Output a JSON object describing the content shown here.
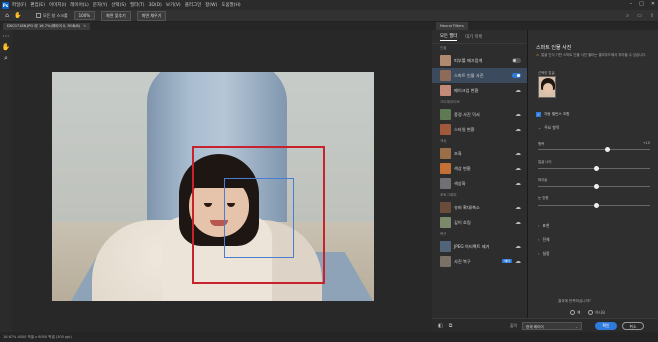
{
  "menubar": {
    "logo": "Ps",
    "items": [
      "파일(F)",
      "편집(E)",
      "이미지(I)",
      "레이어(L)",
      "문자(Y)",
      "선택(S)",
      "필터(T)",
      "3D(D)",
      "보기(V)",
      "플러그인",
      "창(W)",
      "도움말(H)"
    ],
    "window_controls": [
      "–",
      "□",
      "✕"
    ]
  },
  "options": {
    "check_label": "모든 창 스크롤",
    "zoom": "100%",
    "fit_btn": "화면 맞추기",
    "fill_btn": "화면 채우기"
  },
  "document": {
    "tab_label": "DSC07186.JPG @ 16.7%(레이어 0, RGB/8)",
    "close": "✕",
    "status": "16.67%   4000 픽셀 x 6000 픽셀 (300 ppi)"
  },
  "neural_filters": {
    "panel_title": "Neural Filters",
    "tabs": {
      "all": "모든 필터",
      "waitlist": "대기 목록"
    },
    "categories": [
      {
        "label": "인물",
        "items": [
          {
            "name": "피부를 매끄럽게",
            "control": "toggle",
            "on": false,
            "color": "#b08a6e"
          },
          {
            "name": "스마트 인물 사진",
            "control": "toggle",
            "on": true,
            "color": "#8e6b58",
            "selected": true
          },
          {
            "name": "메이크업 변환",
            "control": "cloud",
            "color": "#c48a78"
          }
        ]
      },
      {
        "label": "크리에이티브",
        "items": [
          {
            "name": "풍경 사진 믹서",
            "control": "cloud",
            "color": "#5d7a52"
          },
          {
            "name": "스타일 변환",
            "control": "cloud",
            "color": "#a05a3b"
          }
        ]
      },
      {
        "label": "색상",
        "items": [
          {
            "name": "조화",
            "control": "cloud",
            "color": "#9a6f48"
          },
          {
            "name": "색상 변환",
            "control": "cloud",
            "color": "#c27036"
          },
          {
            "name": "색상화",
            "control": "cloud",
            "color": "#6f6f74"
          }
        ]
      },
      {
        "label": "포토그래피",
        "items": [
          {
            "name": "슈퍼 확대/축소",
            "control": "cloud",
            "color": "#6b4c3a"
          },
          {
            "name": "깊이 흐림",
            "control": "cloud",
            "color": "#7b8a6a"
          }
        ]
      },
      {
        "label": "복구",
        "items": [
          {
            "name": "JPEG 아티팩트 제거",
            "control": "cloud",
            "color": "#516478"
          },
          {
            "name": "사진 복구",
            "control": "cloud",
            "beta": "베타",
            "color": "#7b7065"
          }
        ]
      }
    ],
    "settings": {
      "title": "스마트 인물 사진",
      "info": "얼굴 인식 기반 스마트 인물 사진 필터는 클라우드에서 처리될 수 있습니다.",
      "selected_face_label": "선택한 얼굴",
      "auto_balance_label": "자동 밸런스 조합",
      "featured_section": "주요 항목",
      "sliders": [
        {
          "label": "행복",
          "value": "+10",
          "pos": 0.6
        },
        {
          "label": "얼굴 나이",
          "value": "",
          "pos": 0.5
        },
        {
          "label": "머리숱",
          "value": "",
          "pos": 0.5
        },
        {
          "label": "눈 방향",
          "value": "",
          "pos": 0.5
        }
      ],
      "collapsed_sections": [
        "표현",
        "전체",
        "설정"
      ],
      "feedback_question": "결과에 만족하십니까?",
      "yes": "예",
      "no": "아니요"
    },
    "footer": {
      "output_label": "출력",
      "output_value": "현재 레이어",
      "ok": "확인",
      "cancel": "취소"
    }
  }
}
